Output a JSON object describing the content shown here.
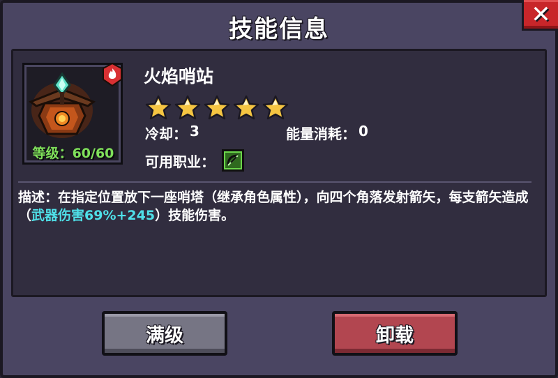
{
  "dialog": {
    "title": "技能信息",
    "close_label": "✕"
  },
  "skill": {
    "name": "火焰哨站",
    "level_text": "等级：60/60",
    "stars_rating": 5,
    "stars_max": 5,
    "cooldown_label": "冷却：",
    "cooldown_value": "3",
    "energy_label": "能量消耗：",
    "energy_value": "0",
    "classes_label": "可用职业：",
    "class_icon": "bow-icon",
    "element_icon": "fire-icon"
  },
  "description": {
    "prefix": "描述：在指定位置放下一座哨塔（继承角色属性），向四个角落发射箭矢，每支箭矢造成（",
    "highlight": "武器伤害69%+245",
    "suffix": "）技能伤害。"
  },
  "buttons": {
    "max_label": "满级",
    "unload_label": "卸载"
  },
  "colors": {
    "level_green": "#7fe05a",
    "highlight_cyan": "#4fe0e8",
    "star_gold": "#f5c542",
    "close_red": "#c8262a",
    "unload_red": "#b24650",
    "max_gray": "#767584"
  }
}
